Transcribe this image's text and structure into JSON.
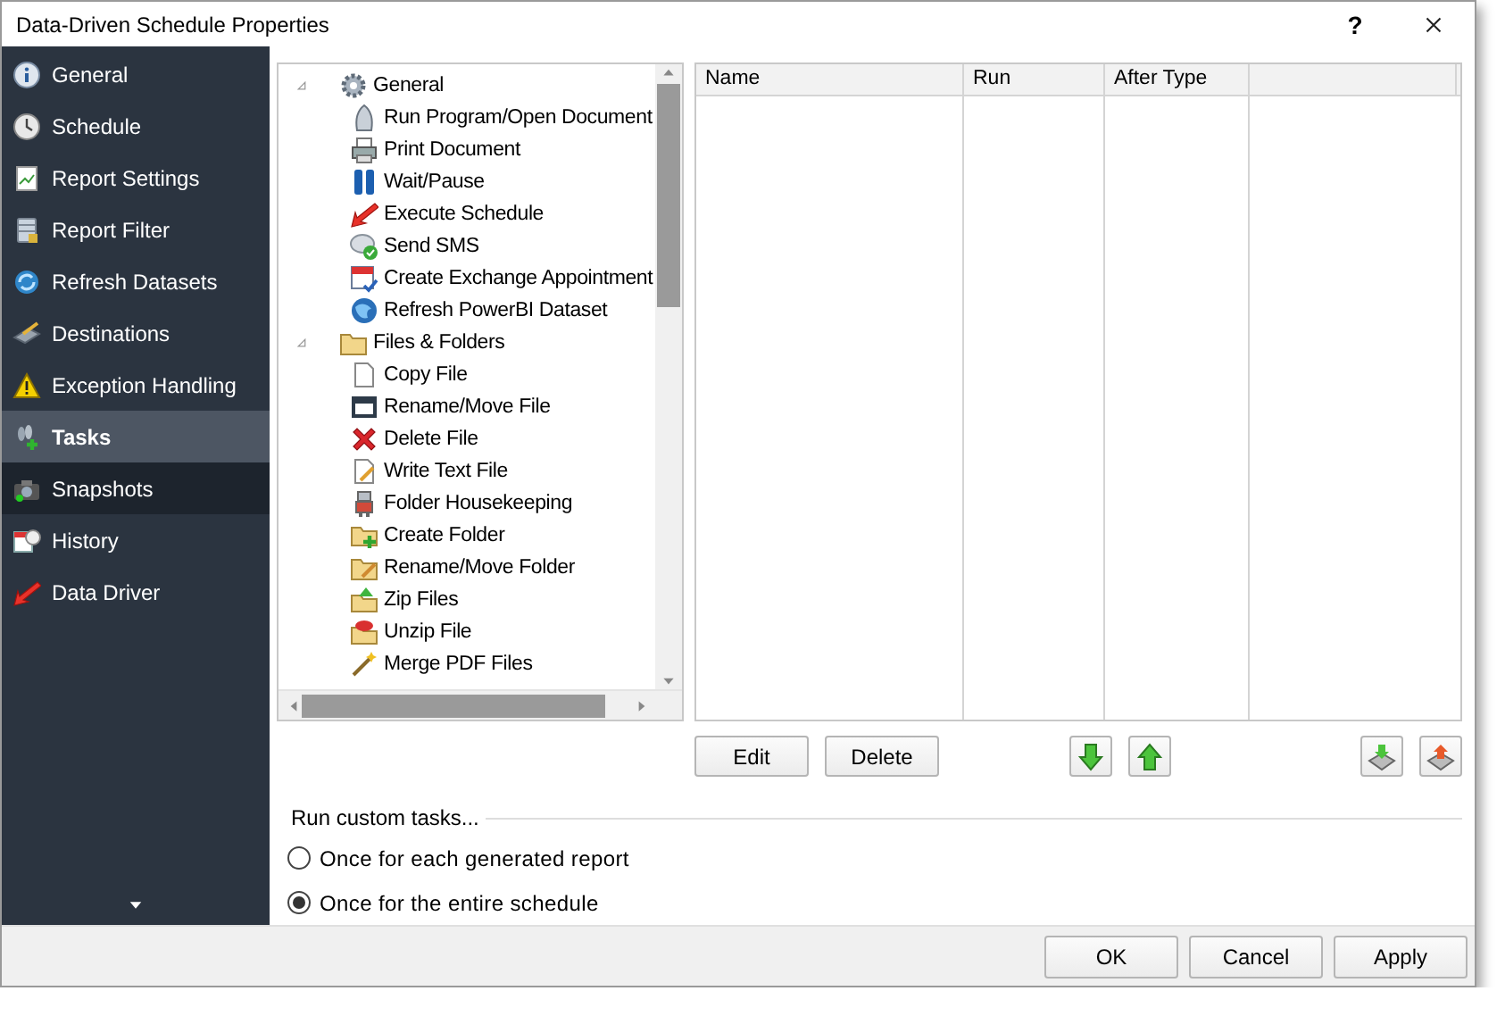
{
  "window": {
    "title": "Data-Driven Schedule Properties",
    "help": "?"
  },
  "sidebar": {
    "items": [
      {
        "label": "General",
        "selected": false,
        "hovered": false
      },
      {
        "label": "Schedule",
        "selected": false,
        "hovered": false
      },
      {
        "label": "Report Settings",
        "selected": false,
        "hovered": false
      },
      {
        "label": "Report Filter",
        "selected": false,
        "hovered": false
      },
      {
        "label": "Refresh Datasets",
        "selected": false,
        "hovered": false
      },
      {
        "label": "Destinations",
        "selected": false,
        "hovered": false
      },
      {
        "label": "Exception Handling",
        "selected": false,
        "hovered": false
      },
      {
        "label": "Tasks",
        "selected": true,
        "hovered": false
      },
      {
        "label": "Snapshots",
        "selected": false,
        "hovered": true
      },
      {
        "label": "History",
        "selected": false,
        "hovered": false
      },
      {
        "label": "Data Driver",
        "selected": false,
        "hovered": false
      }
    ]
  },
  "task_tree": [
    {
      "label": "General",
      "expanded": true,
      "children": [
        {
          "label": "Run Program/Open Document"
        },
        {
          "label": "Print Document"
        },
        {
          "label": "Wait/Pause"
        },
        {
          "label": "Execute Schedule"
        },
        {
          "label": "Send SMS"
        },
        {
          "label": "Create Exchange Appointment"
        },
        {
          "label": "Refresh PowerBI Dataset"
        }
      ]
    },
    {
      "label": "Files & Folders",
      "expanded": true,
      "children": [
        {
          "label": "Copy File"
        },
        {
          "label": "Rename/Move File"
        },
        {
          "label": "Delete File"
        },
        {
          "label": "Write Text File"
        },
        {
          "label": "Folder Housekeeping"
        },
        {
          "label": "Create Folder"
        },
        {
          "label": "Rename/Move Folder"
        },
        {
          "label": "Zip Files"
        },
        {
          "label": "Unzip File"
        },
        {
          "label": "Merge PDF Files"
        }
      ]
    }
  ],
  "table": {
    "columns": [
      "Name",
      "Run",
      "After Type"
    ]
  },
  "buttons": [
    "Edit",
    "Delete"
  ],
  "run_options": {
    "title": "Run custom tasks...",
    "options": [
      {
        "label": "Once for each generated report",
        "selected": false
      },
      {
        "label": "Once for the entire schedule",
        "selected": true
      }
    ]
  },
  "footer": {
    "buttons": [
      "OK",
      "Cancel",
      "Apply"
    ]
  }
}
